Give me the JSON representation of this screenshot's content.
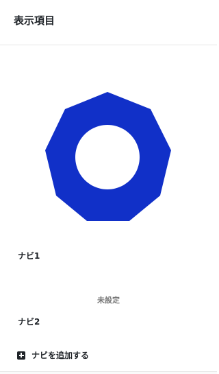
{
  "header": {
    "title": "表示項目"
  },
  "logo": {
    "icon": "heptagon-ring-logo",
    "color": "#1130c8"
  },
  "navs": [
    {
      "label": "ナビ1"
    },
    {
      "label": "ナビ2"
    }
  ],
  "unset_label": "未設定",
  "add_nav": {
    "label": "ナビを追加する",
    "icon": "plus-square-icon"
  }
}
